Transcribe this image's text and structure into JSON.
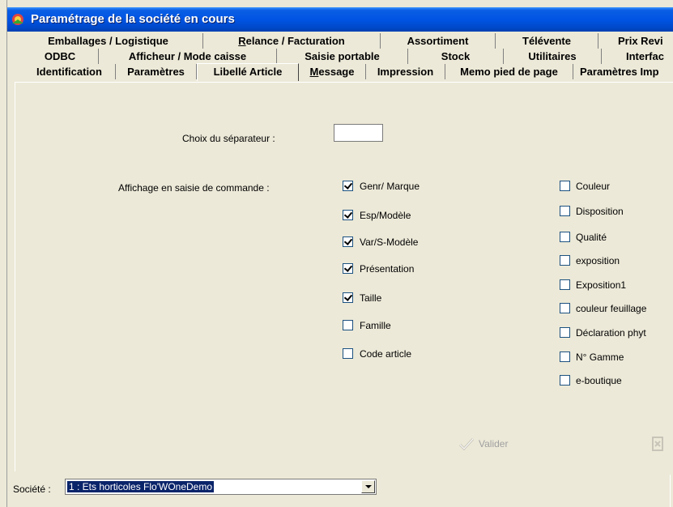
{
  "window": {
    "title": "Paramétrage de la société en cours"
  },
  "tabs": {
    "row1": [
      "Emballages / Logistique",
      "Relance / Facturation",
      "Assortiment",
      "Télévente",
      "Prix Revi"
    ],
    "row2": [
      "ODBC",
      "Afficheur / Mode caisse",
      "Saisie portable",
      "Stock",
      "Utilitaires",
      "Interfac"
    ],
    "row3": [
      "Identification",
      "Paramètres",
      "Libellé Article",
      "Message",
      "Impression",
      "Memo pied de page",
      "Paramètres Imp"
    ],
    "active": "Libellé Article"
  },
  "form": {
    "separator_label": "Choix du séparateur :",
    "separator_value": "",
    "display_label": "Affichage en saisie de commande :",
    "left_options": [
      {
        "label": "Genr/ Marque",
        "checked": true
      },
      {
        "label": "Esp/Modèle",
        "checked": true
      },
      {
        "label": "Var/S-Modèle",
        "checked": true
      },
      {
        "label": "Présentation",
        "checked": true
      },
      {
        "label": "Taille",
        "checked": true
      },
      {
        "label": "Famille",
        "checked": false
      },
      {
        "label": "Code article",
        "checked": false
      }
    ],
    "right_options": [
      {
        "label": "Couleur",
        "checked": false
      },
      {
        "label": "Disposition",
        "checked": false
      },
      {
        "label": "Qualité",
        "checked": false
      },
      {
        "label": "exposition",
        "checked": false
      },
      {
        "label": "Exposition1",
        "checked": false
      },
      {
        "label": "couleur feuillage",
        "checked": false
      },
      {
        "label": "Déclaration phyt",
        "checked": false
      },
      {
        "label": "N° Gamme",
        "checked": false
      },
      {
        "label": "e-boutique",
        "checked": false
      }
    ]
  },
  "buttons": {
    "validate_label": "Valider"
  },
  "footer": {
    "societe_label": "Société :",
    "societe_value": "1 : Ets horticoles Flo'WOneDemo"
  },
  "icons": {
    "app": "app-icon",
    "validate": "check-icon",
    "corner": "partial-icon"
  }
}
